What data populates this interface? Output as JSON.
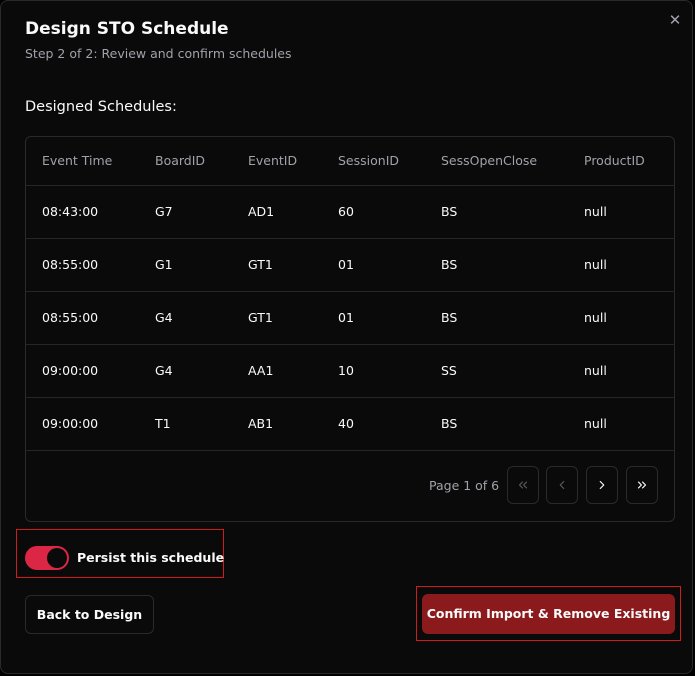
{
  "dialog": {
    "title": "Design STO Schedule",
    "subtitle": "Step 2 of 2: Review and confirm schedules",
    "close_icon": "close-icon",
    "section_label": "Designed Schedules:"
  },
  "table": {
    "columns": [
      "Event Time",
      "BoardID",
      "EventID",
      "SessionID",
      "SessOpenClose",
      "ProductID"
    ],
    "rows": [
      [
        "08:43:00",
        "G7",
        "AD1",
        "60",
        "BS",
        "null"
      ],
      [
        "08:55:00",
        "G1",
        "GT1",
        "01",
        "BS",
        "null"
      ],
      [
        "08:55:00",
        "G4",
        "GT1",
        "01",
        "BS",
        "null"
      ],
      [
        "09:00:00",
        "G4",
        "AA1",
        "10",
        "SS",
        "null"
      ],
      [
        "09:00:00",
        "T1",
        "AB1",
        "40",
        "BS",
        "null"
      ]
    ]
  },
  "pagination": {
    "text": "Page 1 of 6",
    "buttons": [
      {
        "icon": "chevrons-left-icon",
        "enabled": false
      },
      {
        "icon": "chevron-left-icon",
        "enabled": false
      },
      {
        "icon": "chevron-right-icon",
        "enabled": true
      },
      {
        "icon": "chevrons-right-icon",
        "enabled": true
      }
    ]
  },
  "persist": {
    "label": "Persist this schedule",
    "checked": true
  },
  "actions": {
    "back_label": "Back to Design",
    "confirm_label": "Confirm Import & Remove Existing"
  },
  "colors": {
    "background": "#0a0a0a",
    "toggle_on": "#dc2646",
    "confirm_button": "#8b1a1d",
    "highlight_outline": "#d11a1a"
  }
}
